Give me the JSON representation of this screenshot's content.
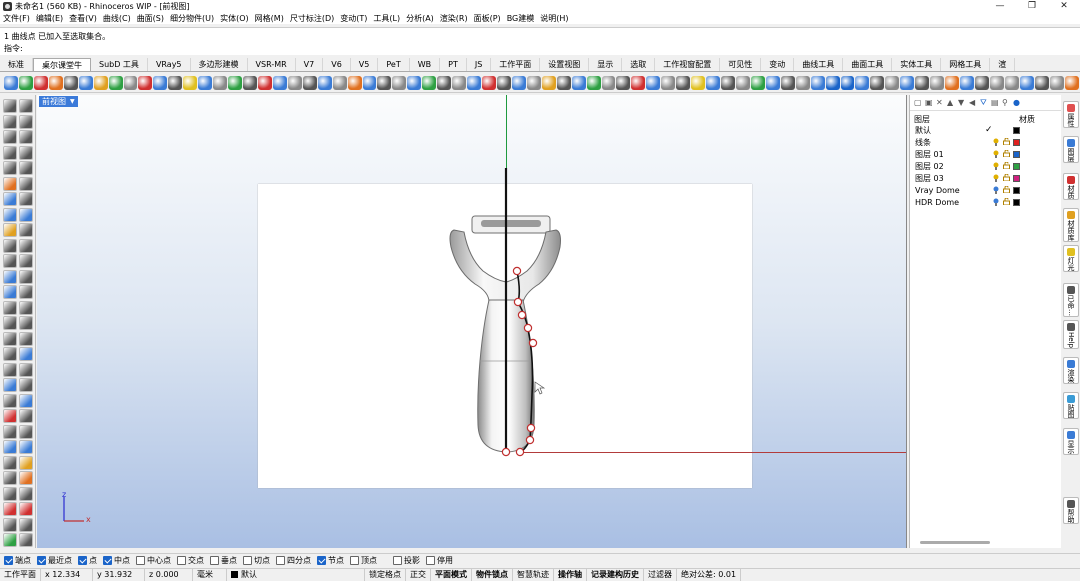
{
  "window": {
    "title": "未命名1 (560 KB) - Rhinoceros WIP - [前视图]",
    "buttons": [
      "—",
      "❐",
      "✕"
    ]
  },
  "menu": [
    "文件(F)",
    "编辑(E)",
    "查看(V)",
    "曲线(C)",
    "曲面(S)",
    "细分物件(U)",
    "实体(O)",
    "网格(M)",
    "尺寸标注(D)",
    "变动(T)",
    "工具(L)",
    "分析(A)",
    "渲染(R)",
    "面板(P)",
    "BG建模",
    "说明(H)"
  ],
  "command": {
    "history": "1 曲线点 已加入至选取集合。",
    "prompt": "指令:",
    "value": ""
  },
  "tabs": [
    "标准",
    "桌尔课堂牛",
    "SubD 工具",
    "VRay5",
    "多边形建模",
    "VSR-MR",
    "V7",
    "V6",
    "V5",
    "PeT",
    "WB",
    "PT",
    "JS",
    "工作平面",
    "设置视图",
    "显示",
    "选取",
    "工作视窗配置",
    "可见性",
    "变动",
    "曲线工具",
    "曲面工具",
    "实体工具",
    "网格工具",
    "渲"
  ],
  "active_tab_index": 1,
  "viewport": {
    "label": "前视图",
    "axis_x": "x",
    "axis_z": "z"
  },
  "layers_panel": {
    "header_layer": "图层",
    "header_material": "材质",
    "rows": [
      {
        "name": "默认",
        "check": "✓",
        "color": "#000000",
        "bulb_color": "",
        "show_icons": false
      },
      {
        "name": "线条",
        "check": "",
        "color": "#e02020",
        "bulb_color": "#e0b000",
        "show_icons": true
      },
      {
        "name": "图层 01",
        "check": "",
        "color": "#1a64c9",
        "bulb_color": "#e0b000",
        "show_icons": true
      },
      {
        "name": "图层 02",
        "check": "",
        "color": "#2ea043",
        "bulb_color": "#e0b000",
        "show_icons": true
      },
      {
        "name": "图层 03",
        "check": "",
        "color": "#d02080",
        "bulb_color": "#e0b000",
        "show_icons": true
      },
      {
        "name": "Vray Dome",
        "check": "",
        "color": "#000000",
        "bulb_color": "#3a7bd5",
        "show_icons": true
      },
      {
        "name": "HDR Dome",
        "check": "",
        "color": "#000000",
        "bulb_color": "#3a7bd5",
        "show_icons": true
      }
    ]
  },
  "side_tabs": [
    {
      "label": "属性",
      "icon_color": "#e05050"
    },
    {
      "label": "图层",
      "icon_color": "#3a7bd5"
    },
    {
      "label": "材质",
      "icon_color": "#d03030"
    },
    {
      "label": "材质库",
      "icon_color": "#e0a020"
    },
    {
      "label": "灯光",
      "icon_color": "#e0c020"
    },
    {
      "label": "已命…",
      "icon_color": "#555555"
    },
    {
      "label": "Help",
      "icon_color": "#555555"
    },
    {
      "label": "渲染",
      "icon_color": "#3a7bd5"
    },
    {
      "label": "贴图",
      "icon_color": "#3a9bd5"
    },
    {
      "label": "显示",
      "icon_color": "#3a7bd5"
    },
    {
      "label": "帮助",
      "icon_color": "#555555"
    }
  ],
  "osnaps": [
    {
      "label": "端点",
      "on": true
    },
    {
      "label": "最近点",
      "on": true
    },
    {
      "label": "点",
      "on": true
    },
    {
      "label": "中点",
      "on": true
    },
    {
      "label": "中心点",
      "on": false
    },
    {
      "label": "交点",
      "on": false
    },
    {
      "label": "垂点",
      "on": false
    },
    {
      "label": "切点",
      "on": false
    },
    {
      "label": "四分点",
      "on": false
    },
    {
      "label": "节点",
      "on": true
    },
    {
      "label": "顶点",
      "on": false
    },
    {
      "label": "投影",
      "on": false
    },
    {
      "label": "停用",
      "on": false
    }
  ],
  "status": {
    "cplane": "工作平面",
    "x": "x 12.334",
    "y": "y 31.932",
    "z": "z 0.000",
    "unit": "毫米",
    "layer": "默认",
    "toggles": [
      "锁定格点",
      "正交",
      "平面模式",
      "物件锁点",
      "智慧轨迹",
      "操作轴",
      "记录建构历史",
      "过滤器"
    ],
    "bold_toggles": [
      false,
      false,
      true,
      true,
      false,
      true,
      true,
      false
    ],
    "tolerance": "绝对公差: 0.01"
  },
  "toolbar_icon_colors": [
    "#3a7bd5",
    "#2ea043",
    "#d03030",
    "#e07020",
    "#555",
    "#3a7bd5",
    "#e0a020",
    "#2ea043",
    "#888",
    "#d03030",
    "#3a7bd5",
    "#555",
    "#e0c020",
    "#3a7bd5",
    "#888",
    "#2ea043",
    "#555",
    "#d03030",
    "#3a7bd5",
    "#888",
    "#555",
    "#3a7bd5",
    "#888",
    "#e07020",
    "#3a7bd5",
    "#555",
    "#888",
    "#3a7bd5",
    "#2ea043",
    "#555",
    "#888",
    "#3a7bd5",
    "#d03030",
    "#555",
    "#3a7bd5",
    "#888",
    "#e0a020",
    "#555",
    "#3a7bd5",
    "#2ea043",
    "#888",
    "#555",
    "#d03030",
    "#3a7bd5",
    "#888",
    "#555",
    "#e0c020",
    "#3a7bd5",
    "#555",
    "#888",
    "#2ea043",
    "#3a7bd5",
    "#555",
    "#888",
    "#3a7bd5",
    "#1a64c9",
    "#1a64c9",
    "#3a7bd5",
    "#555",
    "#888",
    "#3a7bd5",
    "#555",
    "#888",
    "#e07020",
    "#3a7bd5",
    "#555",
    "#888",
    "#888",
    "#3a7bd5",
    "#555",
    "#888",
    "#e07020"
  ],
  "left_tool_colors": [
    "#555",
    "#555",
    "#555",
    "#555",
    "#555",
    "#555",
    "#555",
    "#555",
    "#555",
    "#555",
    "#e07020",
    "#555",
    "#3a7bd5",
    "#555",
    "#3a7bd5",
    "#3a7bd5",
    "#e0a020",
    "#555",
    "#555",
    "#555",
    "#555",
    "#555",
    "#3a7bd5",
    "#555",
    "#3a7bd5",
    "#555",
    "#555",
    "#555",
    "#555",
    "#555",
    "#555",
    "#555",
    "#555",
    "#3a7bd5",
    "#555",
    "#555",
    "#3a7bd5",
    "#555",
    "#555",
    "#3a7bd5",
    "#d03030",
    "#555",
    "#555",
    "#555",
    "#3a7bd5",
    "#3a7bd5",
    "#555",
    "#e0a020",
    "#555",
    "#e07020",
    "#555",
    "#555",
    "#d03030",
    "#d03030",
    "#555",
    "#555",
    "#2ea043",
    "#555"
  ]
}
